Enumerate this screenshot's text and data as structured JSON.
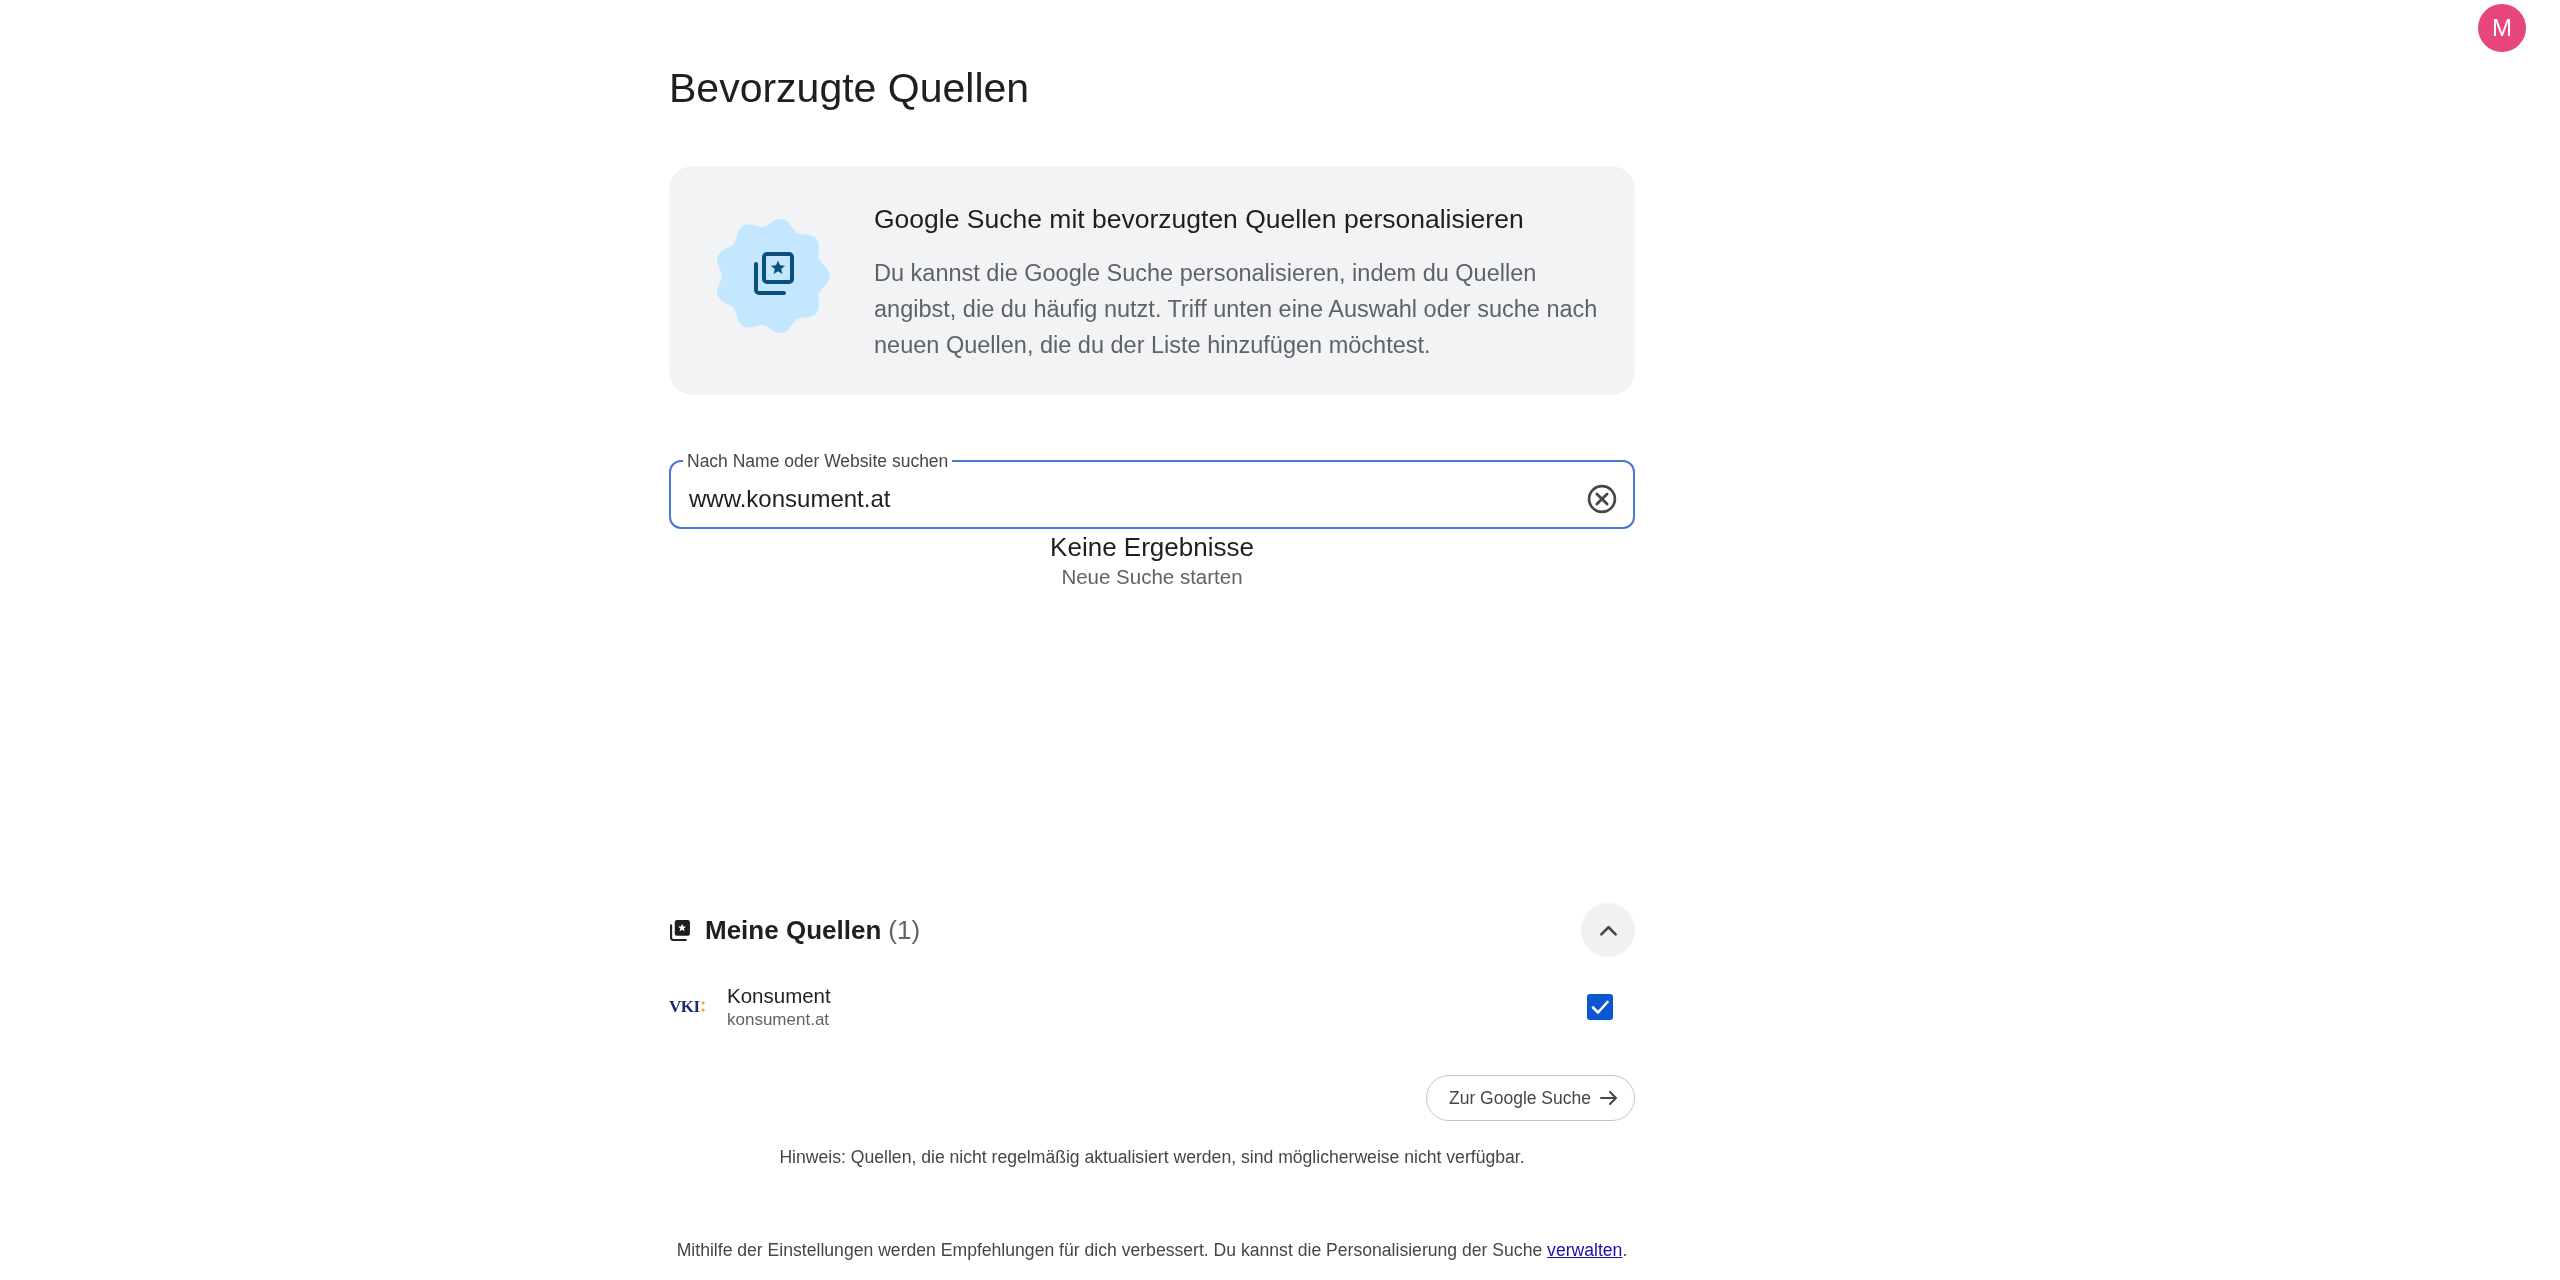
{
  "avatar": {
    "initial": "M"
  },
  "page_title": "Bevorzugte Quellen",
  "intro_card": {
    "heading": "Google Suche mit bevorzugten Quellen personalisieren",
    "body": "Du kannst die Google Suche personalisieren, indem du Quellen angibst, die du häufig nutzt. Triff unten eine Auswahl oder suche nach neuen Quellen, die du der Liste hinzufügen möchtest."
  },
  "search": {
    "label": "Nach Name oder Website suchen",
    "value": "www.konsument.at",
    "focused": true
  },
  "results": {
    "message": "Keine Ergebnisse",
    "hint": "Neue Suche starten"
  },
  "my_sources": {
    "title": "Meine Quellen",
    "count": "(1)",
    "expanded": true,
    "items": [
      {
        "logo": "VKI",
        "name": "Konsument",
        "domain": "konsument.at",
        "checked": true
      }
    ]
  },
  "go_button": {
    "label": "Zur Google Suche"
  },
  "notice": "Hinweis: Quellen, die nicht regelmäßig aktualisiert werden, sind möglicherweise nicht verfügbar.",
  "footer": {
    "text_before": "Mithilfe der Einstellungen werden Empfehlungen für dich verbessert. Du kannst die Personalisierung der Suche",
    "link": "verwalten",
    "text_after": "."
  }
}
